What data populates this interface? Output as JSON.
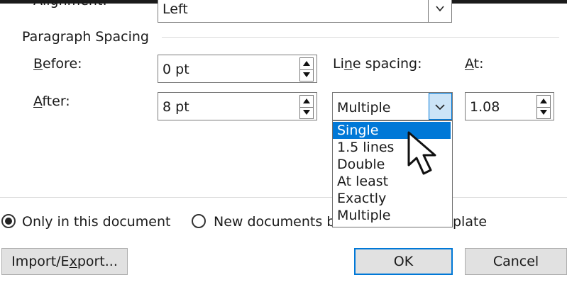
{
  "alignment": {
    "label": "Alignment:",
    "value": "Left"
  },
  "paragraph_spacing": {
    "title": "Paragraph Spacing",
    "before": {
      "label_u": "B",
      "label_rest": "efore:",
      "value": "0 pt"
    },
    "after": {
      "label_u": "A",
      "label_rest": "fter:",
      "value": "8 pt"
    },
    "line_spacing": {
      "label_a": "Li",
      "label_u": "n",
      "label_b": "e spacing:",
      "value": "Multiple"
    },
    "at": {
      "label_u": "A",
      "label_rest": "t:",
      "value": "1.08"
    }
  },
  "line_spacing_options": [
    "Single",
    "1.5 lines",
    "Double",
    "At least",
    "Exactly",
    "Multiple"
  ],
  "selected_option": "Single",
  "scope": {
    "option1": "Only in this document",
    "option2_visible": "New documents b",
    "option2_tail": "plate",
    "selected": "option1"
  },
  "buttons": {
    "import_export_a": "Import/E",
    "import_export_u": "x",
    "import_export_b": "port...",
    "ok": "OK",
    "cancel": "Cancel"
  },
  "colors": {
    "highlight": "#0078d7",
    "button_bg": "#e1e1e1",
    "dropdown_active": "#cce4f7"
  },
  "icons": [
    "spin-up-icon",
    "spin-down-icon",
    "chevron-down-icon",
    "mouse-pointer-icon",
    "radio-selected-icon"
  ]
}
